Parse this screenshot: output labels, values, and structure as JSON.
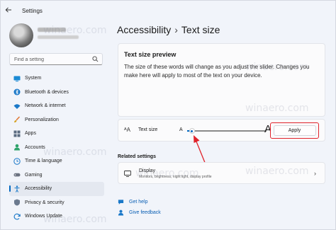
{
  "window": {
    "title": "Settings"
  },
  "sidebar": {
    "search_placeholder": "Find a setting",
    "items": [
      {
        "label": "System",
        "icon": "system-icon",
        "active": false
      },
      {
        "label": "Bluetooth & devices",
        "icon": "bluetooth-icon",
        "active": false
      },
      {
        "label": "Network & internet",
        "icon": "network-icon",
        "active": false
      },
      {
        "label": "Personalization",
        "icon": "brush-icon",
        "active": false
      },
      {
        "label": "Apps",
        "icon": "apps-icon",
        "active": false
      },
      {
        "label": "Accounts",
        "icon": "person-icon",
        "active": false
      },
      {
        "label": "Time & language",
        "icon": "globe-clock-icon",
        "active": false
      },
      {
        "label": "Gaming",
        "icon": "gamepad-icon",
        "active": false
      },
      {
        "label": "Accessibility",
        "icon": "accessibility-icon",
        "active": true
      },
      {
        "label": "Privacy & security",
        "icon": "shield-icon",
        "active": false
      },
      {
        "label": "Windows Update",
        "icon": "update-icon",
        "active": false
      }
    ]
  },
  "breadcrumb": {
    "parent": "Accessibility",
    "separator": "›",
    "current": "Text size"
  },
  "preview": {
    "title": "Text size preview",
    "text": "The size of these words will change as you adjust the slider. Changes you make here will apply to most of the text on your device."
  },
  "text_size": {
    "label": "Text size",
    "small_a": "A",
    "large_a": "A",
    "slider_value_fraction": 0.06,
    "apply_label": "Apply"
  },
  "related": {
    "header": "Related settings",
    "display_title": "Display",
    "display_subtitle": "Monitors, brightness, night light, display profile"
  },
  "links": {
    "help": "Get help",
    "feedback": "Give feedback"
  },
  "watermark": "winaero.com",
  "colors": {
    "accent": "#0067c0",
    "highlight_red": "#e0222a"
  }
}
